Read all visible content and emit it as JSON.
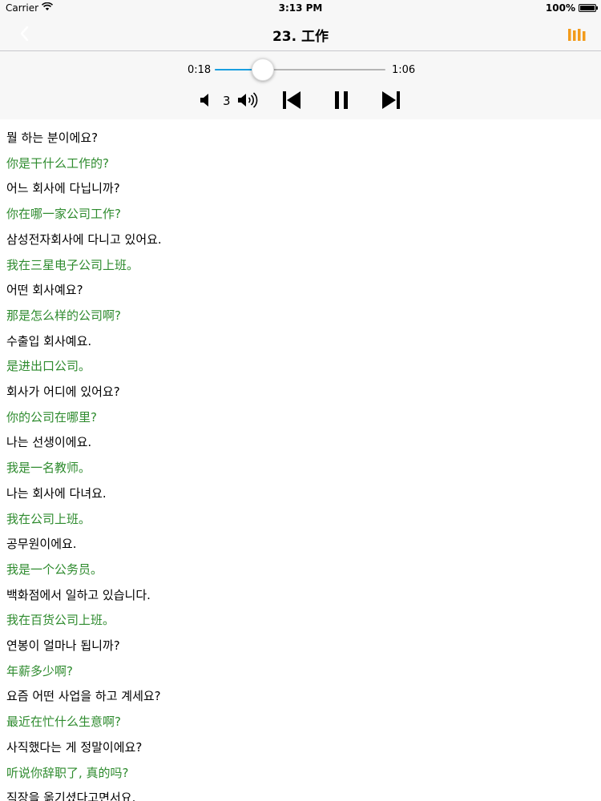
{
  "status_bar": {
    "carrier": "Carrier",
    "time": "3:13 PM",
    "battery": "100%"
  },
  "nav": {
    "title": "23. 工作",
    "back_icon": "chevron-left-icon",
    "right_icon": "bars-icon",
    "accent_color": "#f29b1b"
  },
  "player": {
    "current_time": "0:18",
    "total_time": "1:06",
    "progress": 0.28,
    "volume_level": "3",
    "progress_color": "#1a9fe0"
  },
  "lines": [
    {
      "lang": "ko",
      "text": "뭘 하는 분이에요?"
    },
    {
      "lang": "zh",
      "text": "你是干什么工作的?"
    },
    {
      "lang": "ko",
      "text": "어느 회사에 다닙니까?"
    },
    {
      "lang": "zh",
      "text": "你在哪一家公司工作?"
    },
    {
      "lang": "ko",
      "text": "삼성전자회사에 다니고 있어요."
    },
    {
      "lang": "zh",
      "text": "我在三星电子公司上班。"
    },
    {
      "lang": "ko",
      "text": "어떤 회사예요?"
    },
    {
      "lang": "zh",
      "text": "那是怎么样的公司啊?"
    },
    {
      "lang": "ko",
      "text": "수출입 회사예요."
    },
    {
      "lang": "zh",
      "text": "是进出口公司。"
    },
    {
      "lang": "ko",
      "text": "회사가 어디에 있어요?"
    },
    {
      "lang": "zh",
      "text": "你的公司在哪里?"
    },
    {
      "lang": "ko",
      "text": "나는 선생이에요."
    },
    {
      "lang": "zh",
      "text": "我是一名教师。"
    },
    {
      "lang": "ko",
      "text": "나는 회사에 다녀요."
    },
    {
      "lang": "zh",
      "text": "我在公司上班。"
    },
    {
      "lang": "ko",
      "text": "공무원이에요."
    },
    {
      "lang": "zh",
      "text": "我是一个公务员。"
    },
    {
      "lang": "ko",
      "text": "백화점에서 일하고 있습니다."
    },
    {
      "lang": "zh",
      "text": "我在百货公司上班。"
    },
    {
      "lang": "ko",
      "text": "연봉이 얼마나 됩니까?"
    },
    {
      "lang": "zh",
      "text": "年薪多少啊?"
    },
    {
      "lang": "ko",
      "text": "요즘 어떤 사업을 하고 계세요?"
    },
    {
      "lang": "zh",
      "text": "最近在忙什么生意啊?"
    },
    {
      "lang": "ko",
      "text": "사직했다는 게 정말이에요?"
    },
    {
      "lang": "zh",
      "text": "听说你辞职了, 真的吗?"
    },
    {
      "lang": "ko",
      "text": "직장을 옮기셨다고면서요."
    }
  ]
}
